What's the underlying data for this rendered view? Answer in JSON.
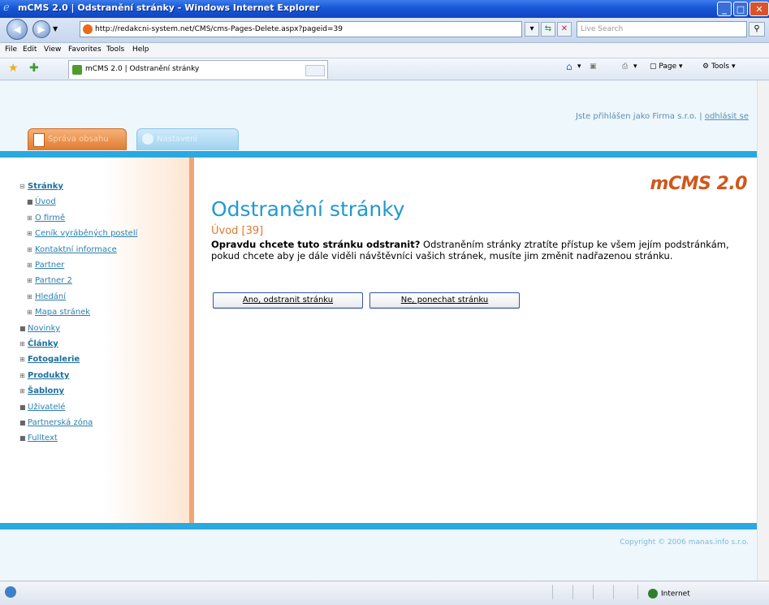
{
  "window": {
    "title": "mCMS 2.0 | Odstranění stránky - Windows Internet Explorer"
  },
  "address_bar": {
    "url": "http://redakcni-system.net/CMS/cms-Pages-Delete.aspx?pageid=39",
    "search_placeholder": "Live Search"
  },
  "menu": [
    "File",
    "Edit",
    "View",
    "Favorites",
    "Tools",
    "Help"
  ],
  "browser_tab": {
    "label": "mCMS 2.0 | Odstranění stránky"
  },
  "command_bar": {
    "page_label": "Page",
    "tools_label": "Tools"
  },
  "header": {
    "user_prefix": "Jste přihlášen jako Firma s.r.o. | ",
    "logout": "odhlásit se",
    "tabs": [
      "Správa obsahu",
      "Nastavení"
    ]
  },
  "sidebar": {
    "items": [
      {
        "label": "Stránky",
        "marker": "⊟",
        "level": 0,
        "bold": true
      },
      {
        "label": "Úvod",
        "marker": "■",
        "level": 1,
        "bold": false
      },
      {
        "label": "O firmě",
        "marker": "⊞",
        "level": 1,
        "bold": false
      },
      {
        "label": "Ceník vyráběných postelí",
        "marker": "⊞",
        "level": 1,
        "bold": false
      },
      {
        "label": "Kontaktní informace",
        "marker": "⊞",
        "level": 1,
        "bold": false
      },
      {
        "label": "Partner",
        "marker": "⊞",
        "level": 1,
        "bold": false
      },
      {
        "label": "Partner 2",
        "marker": "⊞",
        "level": 1,
        "bold": false
      },
      {
        "label": "Hledání",
        "marker": "⊞",
        "level": 1,
        "bold": false
      },
      {
        "label": "Mapa stránek",
        "marker": "⊞",
        "level": 1,
        "bold": false
      },
      {
        "label": "Novinky",
        "marker": "■",
        "level": 0,
        "bold": false
      },
      {
        "label": "Články",
        "marker": "⊞",
        "level": 0,
        "bold": true
      },
      {
        "label": "Fotogalerie",
        "marker": "⊞",
        "level": 0,
        "bold": true
      },
      {
        "label": "Produkty",
        "marker": "⊞",
        "level": 0,
        "bold": true
      },
      {
        "label": "Šablony",
        "marker": "⊞",
        "level": 0,
        "bold": true
      },
      {
        "label": "Uživatelé",
        "marker": "■",
        "level": 0,
        "bold": false
      },
      {
        "label": "Partnerská zóna",
        "marker": "■",
        "level": 0,
        "bold": false
      },
      {
        "label": "Fulltext",
        "marker": "■",
        "level": 0,
        "bold": false
      }
    ]
  },
  "main": {
    "logo": "mCMS 2.0",
    "heading": "Odstranění stránky",
    "subheading": "Úvod [39]",
    "question": "Opravdu chcete tuto stránku odstranit?",
    "message": " Odstraněním stránky ztratíte přístup ke všem jejím podstránkám, pokud chcete aby je dále viděli návštěvníci vašich stránek, musíte jim změnit nadřazenou stránku.",
    "confirm_button": "Ano, odstranit stránku",
    "cancel_button": "Ne, ponechat stránku"
  },
  "footer": {
    "copyright": "Copyright © 2006 manas.info s.r.o."
  },
  "status_bar": {
    "zone": "Internet"
  }
}
